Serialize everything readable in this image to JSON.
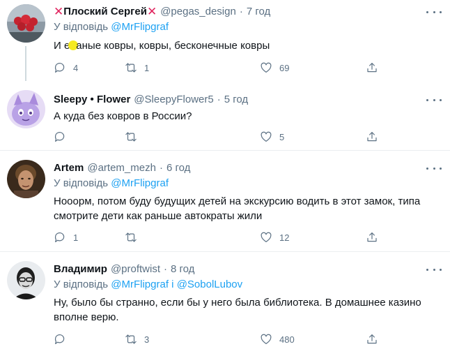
{
  "tweets": [
    {
      "name": "Плоский Сергей",
      "handle": "@pegas_design",
      "time": "7 год",
      "reply_prefix": "У відповідь",
      "reply_to": "@MrFlipgraf",
      "reply_joiner": "",
      "reply_to2": "",
      "text_before": "И е",
      "text_after": "аные ковры, ковры, бесконечные ковры",
      "text": "",
      "replies": "4",
      "retweets": "1",
      "likes": "69"
    },
    {
      "name": "Sleepy • Flower",
      "handle": "@SleepyFlower5",
      "time": "5 год",
      "text": "А куда без ковров в России?",
      "replies": "",
      "retweets": "",
      "likes": "5"
    },
    {
      "name": "Artem",
      "handle": "@artem_mezh",
      "time": "6 год",
      "reply_prefix": "У відповідь",
      "reply_to": "@MrFlipgraf",
      "text": "Нооорм, потом буду будущих детей на экскурсию водить в этот замок, типа смотрите дети как раньше автократы жили",
      "replies": "1",
      "retweets": "",
      "likes": "12"
    },
    {
      "name": "Владимир",
      "handle": "@proftwist",
      "time": "8 год",
      "reply_prefix": "У відповідь",
      "reply_to": "@MrFlipgraf",
      "reply_joiner": "і",
      "reply_to2": "@SobolLubov",
      "text": "Ну, было бы странно, если бы у него была библиотека. В домашнее казино вполне верю.",
      "replies": "",
      "retweets": "3",
      "likes": "480"
    }
  ],
  "colors": {
    "accent": "#1da1f2",
    "secondary_text": "#5b7083",
    "x_mark": "#e0245e",
    "divider": "#ebeef0"
  },
  "icons": [
    "close-x-icon",
    "more-icon",
    "reply-icon",
    "retweet-icon",
    "like-icon",
    "share-icon"
  ]
}
